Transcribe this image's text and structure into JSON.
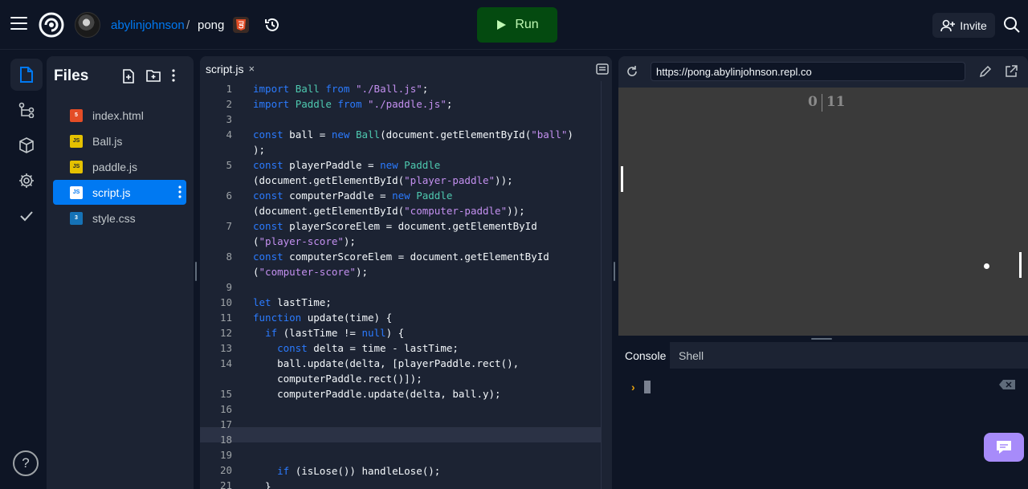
{
  "topbar": {
    "owner": "abylinjohnson",
    "separator": "/",
    "repl_name": "pong",
    "run_label": "Run",
    "invite_label": "Invite"
  },
  "files": {
    "title": "Files",
    "items": [
      {
        "name": "index.html",
        "type": "html"
      },
      {
        "name": "Ball.js",
        "type": "js"
      },
      {
        "name": "paddle.js",
        "type": "js"
      },
      {
        "name": "script.js",
        "type": "js",
        "active": true
      },
      {
        "name": "style.css",
        "type": "css"
      }
    ]
  },
  "editor": {
    "tab_label": "script.js",
    "tab_close": "×",
    "line_numbers": [
      "1",
      "2",
      "3",
      "4",
      "",
      "5",
      "",
      "6",
      "",
      "7",
      "",
      "8",
      "",
      "9",
      "10",
      "11",
      "12",
      "13",
      "14",
      "",
      "15",
      "16",
      "17",
      "18",
      "19",
      "20",
      "21"
    ]
  },
  "webview": {
    "url": "https://pong.abylinjohnson.repl.co",
    "player_score": "0",
    "computer_score": "11"
  },
  "console": {
    "tabs": [
      "Console",
      "Shell"
    ]
  },
  "help_label": "?",
  "colors": {
    "accent": "#0079f2",
    "run_bg": "#044a10",
    "run_text": "#bff8b4",
    "panel": "#1c2333",
    "bg": "#0e1525"
  },
  "icons": [
    "menu-icon",
    "replit-logo",
    "avatar",
    "html5-icon",
    "history-icon",
    "play-icon",
    "invite-icon",
    "search-icon",
    "files-icon",
    "git-icon",
    "packages-icon",
    "settings-icon",
    "check-icon",
    "help-icon",
    "new-file-icon",
    "new-folder-icon",
    "more-icon",
    "refresh-icon",
    "edit-icon",
    "open-new-tab-icon",
    "clear-console-icon",
    "chat-icon"
  ]
}
